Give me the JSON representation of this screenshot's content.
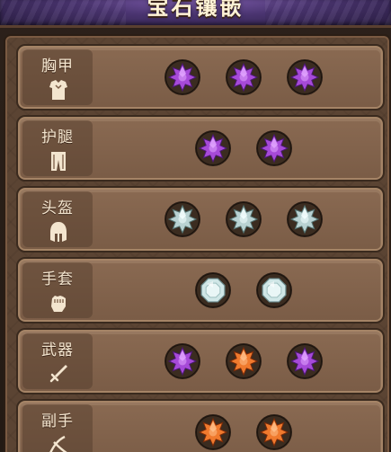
{
  "title": "宝石镶嵌",
  "colors": {
    "purple": "#a64ad8",
    "silver": "#b9d2d2",
    "orange": "#f07a2e",
    "diamond": "#cfe6e6"
  },
  "slots": [
    {
      "label": "胸甲",
      "icon": "chest-armor-icon",
      "gems": [
        "purple-star-gem",
        "purple-star-gem",
        "purple-star-gem"
      ]
    },
    {
      "label": "护腿",
      "icon": "leggings-icon",
      "gems": [
        "purple-star-gem",
        "purple-star-gem"
      ]
    },
    {
      "label": "头盔",
      "icon": "helmet-icon",
      "gems": [
        "silver-star-gem",
        "silver-star-gem",
        "silver-star-gem"
      ]
    },
    {
      "label": "手套",
      "icon": "fist-glove-icon",
      "gems": [
        "diamond-gem",
        "diamond-gem"
      ]
    },
    {
      "label": "武器",
      "icon": "sword-icon",
      "gems": [
        "purple-star-gem",
        "orange-star-gem",
        "purple-star-gem"
      ]
    },
    {
      "label": "副手",
      "icon": "offhand-icon",
      "gems": [
        "orange-star-gem",
        "orange-star-gem"
      ]
    }
  ]
}
